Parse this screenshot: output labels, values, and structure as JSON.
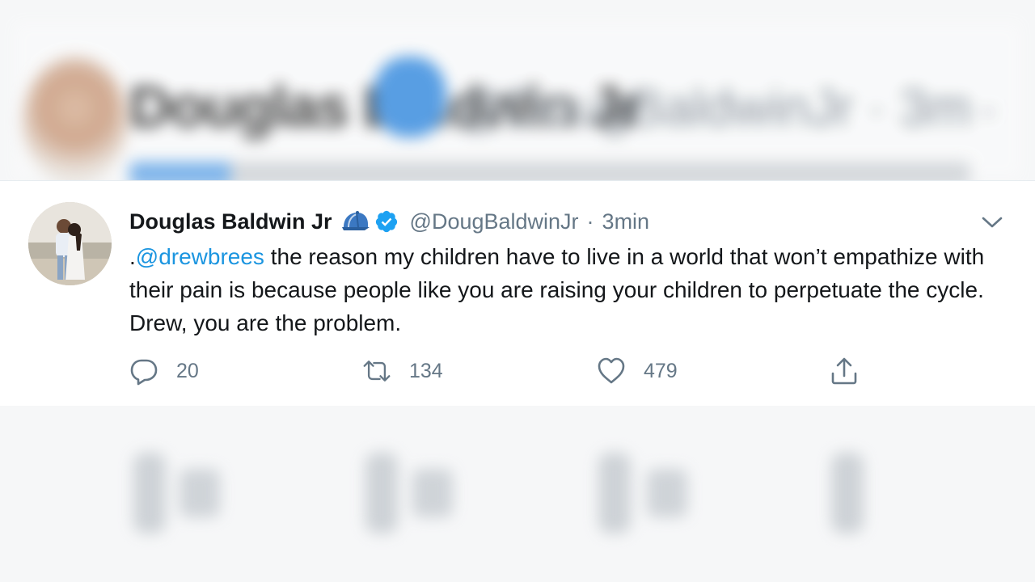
{
  "tweet": {
    "author_name": "Douglas Baldwin Jr",
    "handle": "@DougBaldwinJr",
    "separator": "·",
    "time": "3min",
    "text_prefix": ".",
    "mention": "@drewbrees",
    "text_body": " the reason my children have to live in a world that won’t empathize with their pain is because people like you are raising your children to perpetuate the cycle. Drew, you are the problem.",
    "icons": {
      "cap": "baseball-cap-icon",
      "verified": "verified-badge-icon",
      "menu": "chevron-down-icon"
    }
  },
  "actions": {
    "reply": {
      "icon": "reply-icon",
      "count": "20"
    },
    "retweet": {
      "icon": "retweet-icon",
      "count": "134"
    },
    "like": {
      "icon": "heart-icon",
      "count": "479"
    },
    "share": {
      "icon": "share-icon"
    }
  },
  "background": {
    "name": "Douglas Baldwin Jr",
    "handle": "@DougBaldwinJr · 3m"
  },
  "colors": {
    "link": "#1b95e0",
    "text": "#14171a",
    "secondary": "#657786",
    "verified": "#1da1f2"
  }
}
